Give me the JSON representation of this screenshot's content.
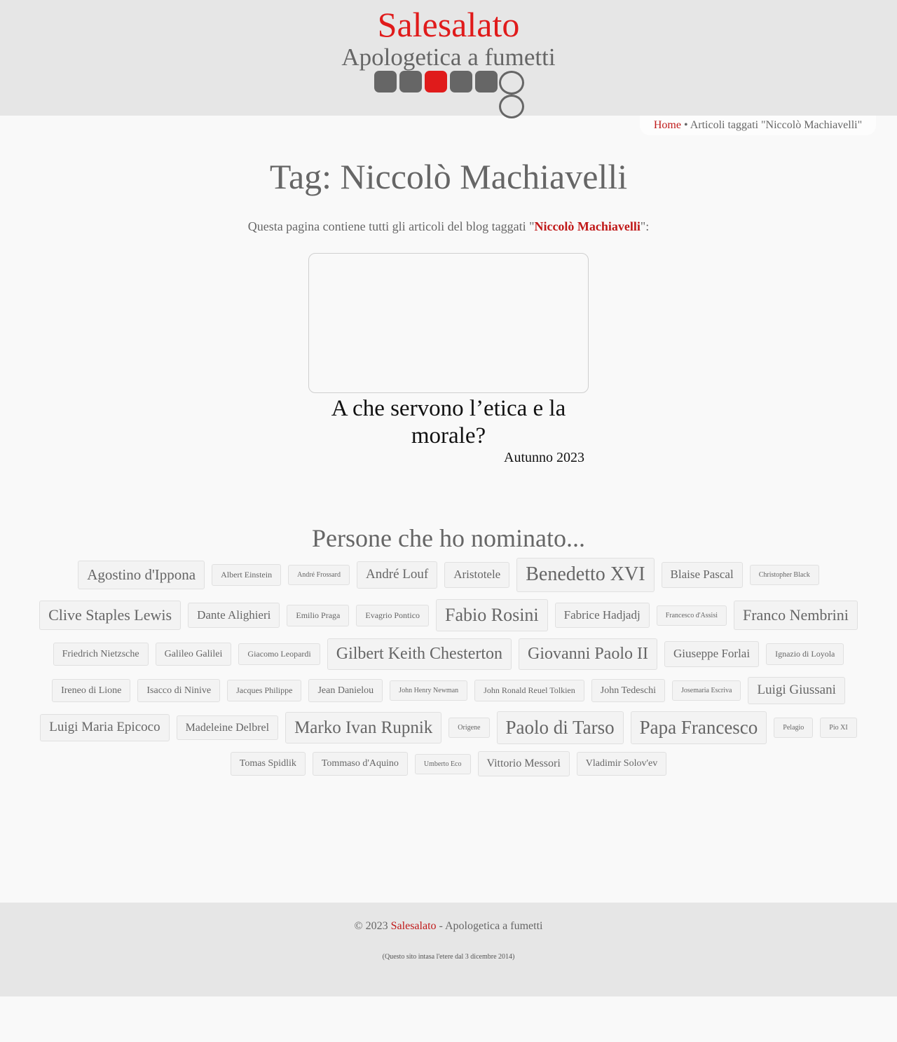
{
  "header": {
    "site_title": "Salesalato",
    "subtitle": "Apologetica a fumetti",
    "colors": {
      "accent": "#e01b1b",
      "logo_gray": "#666666",
      "header_bg": "#e6e6e6"
    }
  },
  "breadcrumb": {
    "home": "Home",
    "separator": "•",
    "current": "Articoli taggati \"Niccolò Machiavelli\""
  },
  "page": {
    "title": "Tag: Niccolò Machiavelli",
    "intro_prefix": "Questa pagina contiene tutti gli articoli del blog taggati \"",
    "intro_tag": "Niccolò Machiavelli",
    "intro_suffix": "\":"
  },
  "post": {
    "title": "A che servono l’etica e la morale?",
    "date": "Autunno 2023"
  },
  "people": {
    "heading": "Persone che ho nominato...",
    "tags": [
      {
        "label": "Agostino d'Ippona",
        "size": 21
      },
      {
        "label": "Albert Einstein",
        "size": 12
      },
      {
        "label": "André Frossard",
        "size": 10
      },
      {
        "label": "André Louf",
        "size": 19
      },
      {
        "label": "Aristotele",
        "size": 17
      },
      {
        "label": "Benedetto XVI",
        "size": 28
      },
      {
        "label": "Blaise Pascal",
        "size": 17
      },
      {
        "label": "Christopher Black",
        "size": 10
      },
      {
        "label": "Clive Staples Lewis",
        "size": 22
      },
      {
        "label": "Dante Alighieri",
        "size": 17
      },
      {
        "label": "Emilio Praga",
        "size": 12
      },
      {
        "label": "Evagrio Pontico",
        "size": 12
      },
      {
        "label": "Fabio Rosini",
        "size": 26
      },
      {
        "label": "Fabrice Hadjadj",
        "size": 17
      },
      {
        "label": "Francesco d'Assisi",
        "size": 10
      },
      {
        "label": "Franco Nembrini",
        "size": 22
      },
      {
        "label": "Friedrich Nietzsche",
        "size": 14
      },
      {
        "label": "Galileo Galilei",
        "size": 14
      },
      {
        "label": "Giacomo Leopardi",
        "size": 12
      },
      {
        "label": "Gilbert Keith Chesterton",
        "size": 24
      },
      {
        "label": "Giovanni Paolo II",
        "size": 24
      },
      {
        "label": "Giuseppe Forlai",
        "size": 17
      },
      {
        "label": "Ignazio di Loyola",
        "size": 12
      },
      {
        "label": "Ireneo di Lione",
        "size": 14
      },
      {
        "label": "Isacco di Ninive",
        "size": 14
      },
      {
        "label": "Jacques Philippe",
        "size": 12
      },
      {
        "label": "Jean Danielou",
        "size": 14
      },
      {
        "label": "John Henry Newman",
        "size": 10
      },
      {
        "label": "John Ronald Reuel Tolkien",
        "size": 12
      },
      {
        "label": "John Tedeschi",
        "size": 14
      },
      {
        "label": "Josemaria Escriva",
        "size": 10
      },
      {
        "label": "Luigi Giussani",
        "size": 19
      },
      {
        "label": "Luigi Maria Epicoco",
        "size": 19
      },
      {
        "label": "Madeleine Delbrel",
        "size": 16
      },
      {
        "label": "Marko Ivan Rupnik",
        "size": 25
      },
      {
        "label": "Origene",
        "size": 10
      },
      {
        "label": "Paolo di Tarso",
        "size": 27
      },
      {
        "label": "Papa Francesco",
        "size": 27
      },
      {
        "label": "Pelagio",
        "size": 10
      },
      {
        "label": "Pio XI",
        "size": 10
      },
      {
        "label": "Tomas Spidlik",
        "size": 14
      },
      {
        "label": "Tommaso d'Aquino",
        "size": 14
      },
      {
        "label": "Umberto Eco",
        "size": 10
      },
      {
        "label": "Vittorio Messori",
        "size": 16
      },
      {
        "label": "Vladimir Solov'ev",
        "size": 14
      }
    ]
  },
  "footer": {
    "copyright": "© 2023",
    "site_link": "Salesalato",
    "tagline": "- Apologetica a fumetti",
    "note": "(Questo sito intasa l'etere dal 3 dicembre 2014)"
  }
}
